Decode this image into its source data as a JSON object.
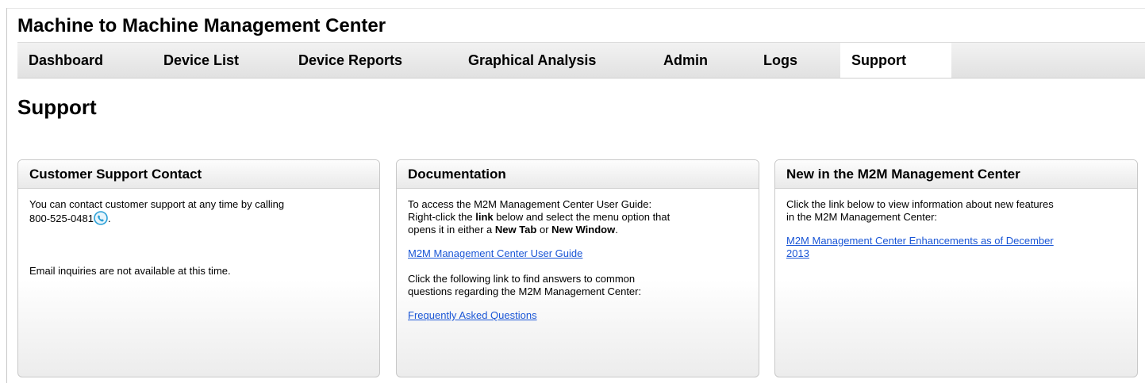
{
  "app": {
    "title": "Machine to Machine Management Center"
  },
  "nav": {
    "tabs": [
      {
        "label": "Dashboard"
      },
      {
        "label": "Device List"
      },
      {
        "label": "Device Reports"
      },
      {
        "label": "Graphical Analysis"
      },
      {
        "label": "Admin"
      },
      {
        "label": "Logs"
      },
      {
        "label": "Support",
        "active": true
      }
    ]
  },
  "page": {
    "title": "Support"
  },
  "panels": {
    "contact": {
      "title": "Customer Support Contact",
      "call_text": "You can contact customer support at any time by calling",
      "phone": "800-525-0481",
      "period": ".",
      "email_text": "Email inquiries are not available at this time."
    },
    "documentation": {
      "title": "Documentation",
      "intro_line1": "To access the M2M Management Center User Guide:",
      "intro_line2_a": "Right-click the ",
      "intro_line2_b": "link",
      "intro_line2_c": " below and select the menu option that",
      "intro_line3_a": "opens it in either a ",
      "intro_line3_b": "New Tab",
      "intro_line3_c": " or ",
      "intro_line3_d": "New Window",
      "intro_line3_e": ".",
      "guide_link": "M2M Management Center User Guide",
      "faq_text_line1": "Click the following link to find answers to common",
      "faq_text_line2": "questions regarding the M2M Management Center:",
      "faq_link": "Frequently Asked Questions"
    },
    "whats_new": {
      "title": "New in the M2M Management Center",
      "text_line1": "Click the link below to view information about new features",
      "text_line2": "in the M2M Management Center:",
      "link_line1": "M2M Management Center Enhancements as of December",
      "link_line2": "2013"
    }
  },
  "colors": {
    "link": "#1a56d6",
    "phone_icon": "#2a9fd6"
  },
  "icons": {
    "phone": "phone-call-icon"
  }
}
